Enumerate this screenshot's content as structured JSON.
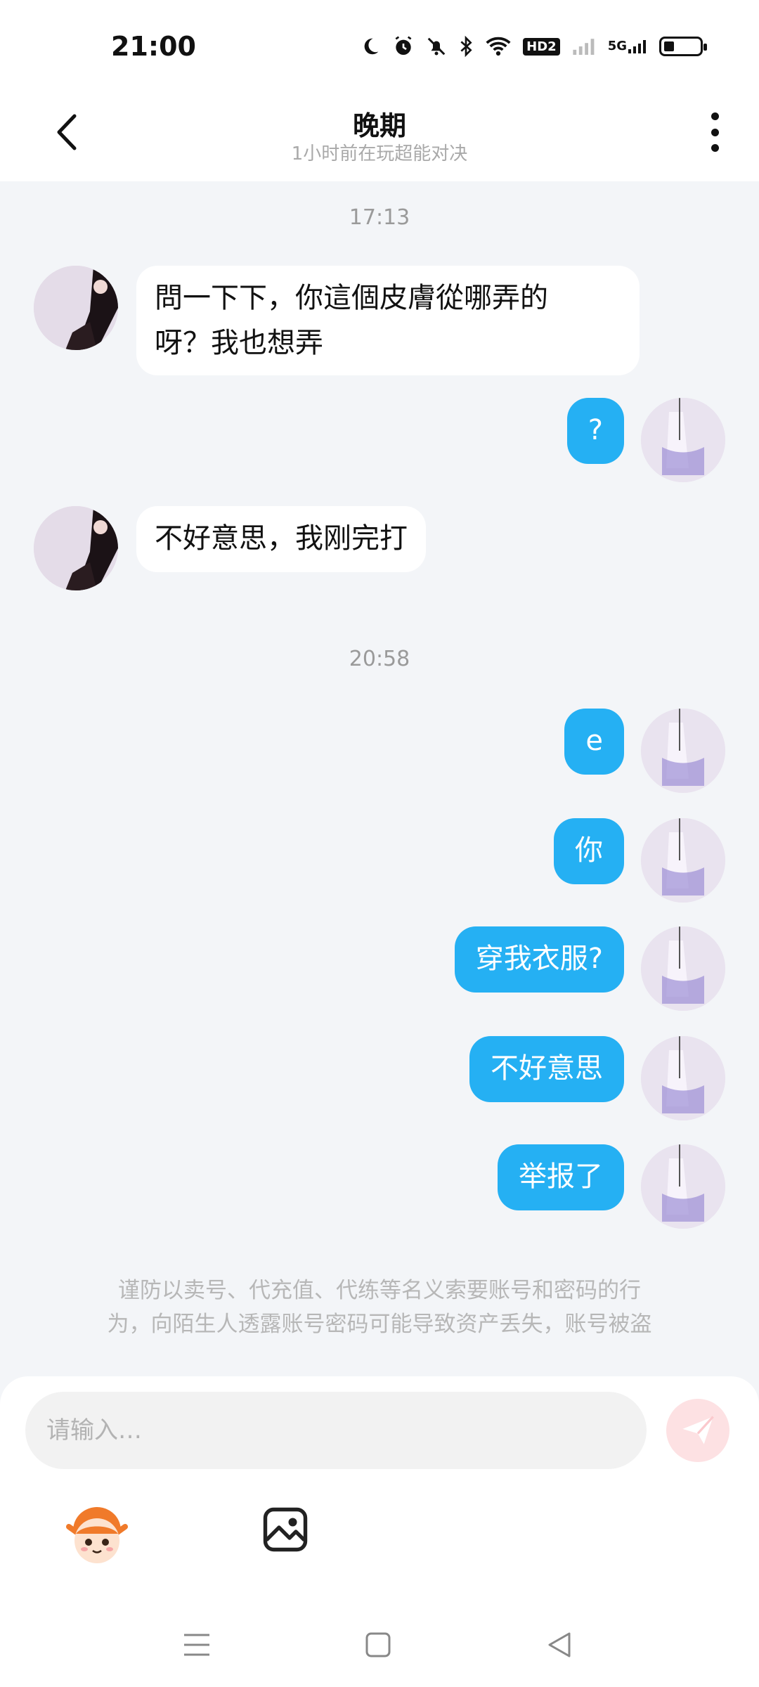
{
  "status_bar": {
    "time": "21:00",
    "icons": [
      "moon-icon",
      "alarm-icon",
      "mute-icon",
      "bluetooth-icon",
      "wifi-icon",
      "hd-icon",
      "signal-icon",
      "5g-signal-icon",
      "battery-icon"
    ],
    "hd_label": "HD2",
    "network_label": "5G"
  },
  "header": {
    "title": "晚期",
    "subtitle": "1小时前在玩超能对决"
  },
  "messages": [
    {
      "type": "timestamp",
      "text": "17:13"
    },
    {
      "type": "incoming",
      "text_lines": [
        "問一下下，你這個皮膚從哪弄的",
        "呀？我也想弄"
      ]
    },
    {
      "type": "outgoing",
      "text": "?"
    },
    {
      "type": "incoming",
      "text": "不好意思，我刚完打"
    },
    {
      "type": "timestamp",
      "text": "20:58"
    },
    {
      "type": "outgoing",
      "text": "e"
    },
    {
      "type": "outgoing",
      "text": "你"
    },
    {
      "type": "outgoing",
      "text": "穿我衣服?"
    },
    {
      "type": "outgoing",
      "text": "不好意思"
    },
    {
      "type": "outgoing",
      "text": "举报了"
    }
  ],
  "warning": {
    "lines": [
      "谨防以卖号、代充值、代练等名义索要账号和密码的行",
      "为，向陌生人透露账号密码可能导致资产丢失，账号被盗"
    ]
  },
  "composer": {
    "placeholder": "请输入…"
  },
  "colors": {
    "outgoing_bubble": "#25b0f3",
    "incoming_bubble": "#ffffff",
    "chat_background": "#f3f5f8",
    "send_button": "#fde1e3"
  }
}
